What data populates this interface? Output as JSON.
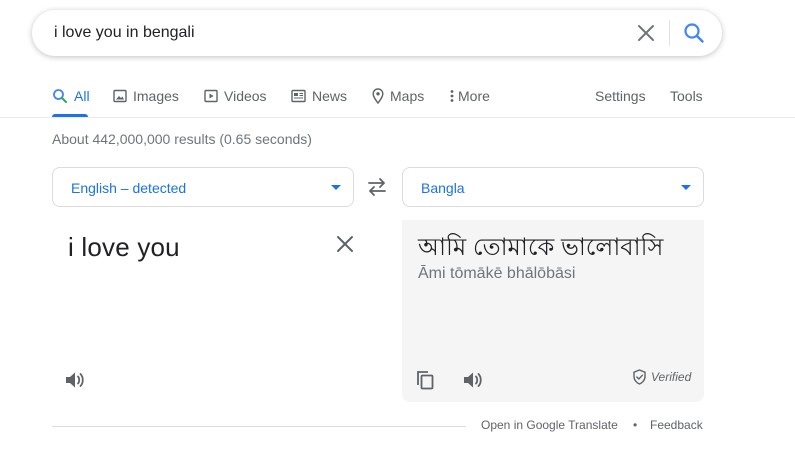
{
  "search": {
    "query": "i love you in bengali"
  },
  "tabs": [
    {
      "label": "All",
      "icon": "search-icon",
      "active": true
    },
    {
      "label": "Images",
      "icon": "image-icon"
    },
    {
      "label": "Videos",
      "icon": "video-icon"
    },
    {
      "label": "News",
      "icon": "news-icon"
    },
    {
      "label": "Maps",
      "icon": "map-pin-icon"
    },
    {
      "label": "More",
      "icon": "more-vert-icon"
    }
  ],
  "tools": {
    "settings": "Settings",
    "tools": "Tools"
  },
  "stats": "About 442,000,000 results (0.65 seconds)",
  "translator": {
    "source_lang": "English – detected",
    "target_lang": "Bangla",
    "source_text": "i love you",
    "target_text": "আমি তোমাকে ভালোবাসি",
    "transliteration": "Āmi tōmākē bhālōbāsi",
    "verified": "Verified"
  },
  "footer": {
    "open_link": "Open in Google Translate",
    "separator": "•",
    "feedback": "Feedback"
  },
  "colors": {
    "accent": "#1a73e8",
    "muted": "#5f6368",
    "panel": "#f5f5f5"
  }
}
